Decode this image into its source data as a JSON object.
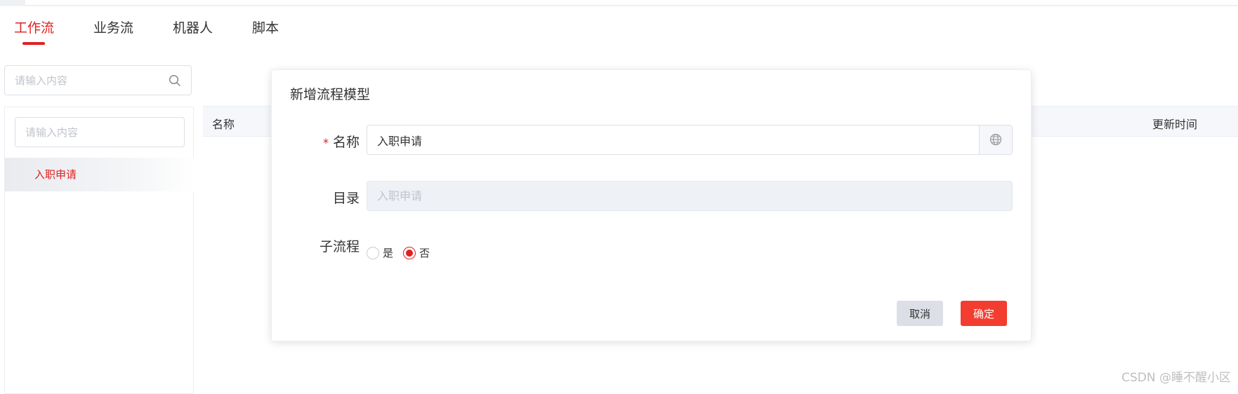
{
  "tabs": [
    {
      "label": "工作流",
      "active": true
    },
    {
      "label": "业务流",
      "active": false
    },
    {
      "label": "机器人",
      "active": false
    },
    {
      "label": "脚本",
      "active": false
    }
  ],
  "left_search": {
    "placeholder": "请输入内容",
    "icon": "search-icon"
  },
  "tree": {
    "search_placeholder": "请输入内容",
    "items": [
      {
        "label": "入职申请",
        "selected": true
      }
    ]
  },
  "table": {
    "columns": [
      "名称",
      "更新时间"
    ]
  },
  "dialog": {
    "title": "新增流程模型",
    "fields": {
      "name": {
        "required_mark": "*",
        "label": "名称",
        "value": "入职申请",
        "icon": "globe-icon"
      },
      "directory": {
        "label": "目录",
        "placeholder": "入职申请",
        "disabled": true
      },
      "subprocess": {
        "label": "子流程",
        "options": [
          "是",
          "否"
        ],
        "selected": "否"
      }
    },
    "buttons": {
      "cancel": "取消",
      "confirm": "确定"
    }
  },
  "watermark": "CSDN @睡不醒小区",
  "colors": {
    "accent": "#e02020",
    "confirm_button": "#f23d30",
    "cancel_button": "#dcdfe6",
    "disabled_input": "#eef1f6"
  }
}
